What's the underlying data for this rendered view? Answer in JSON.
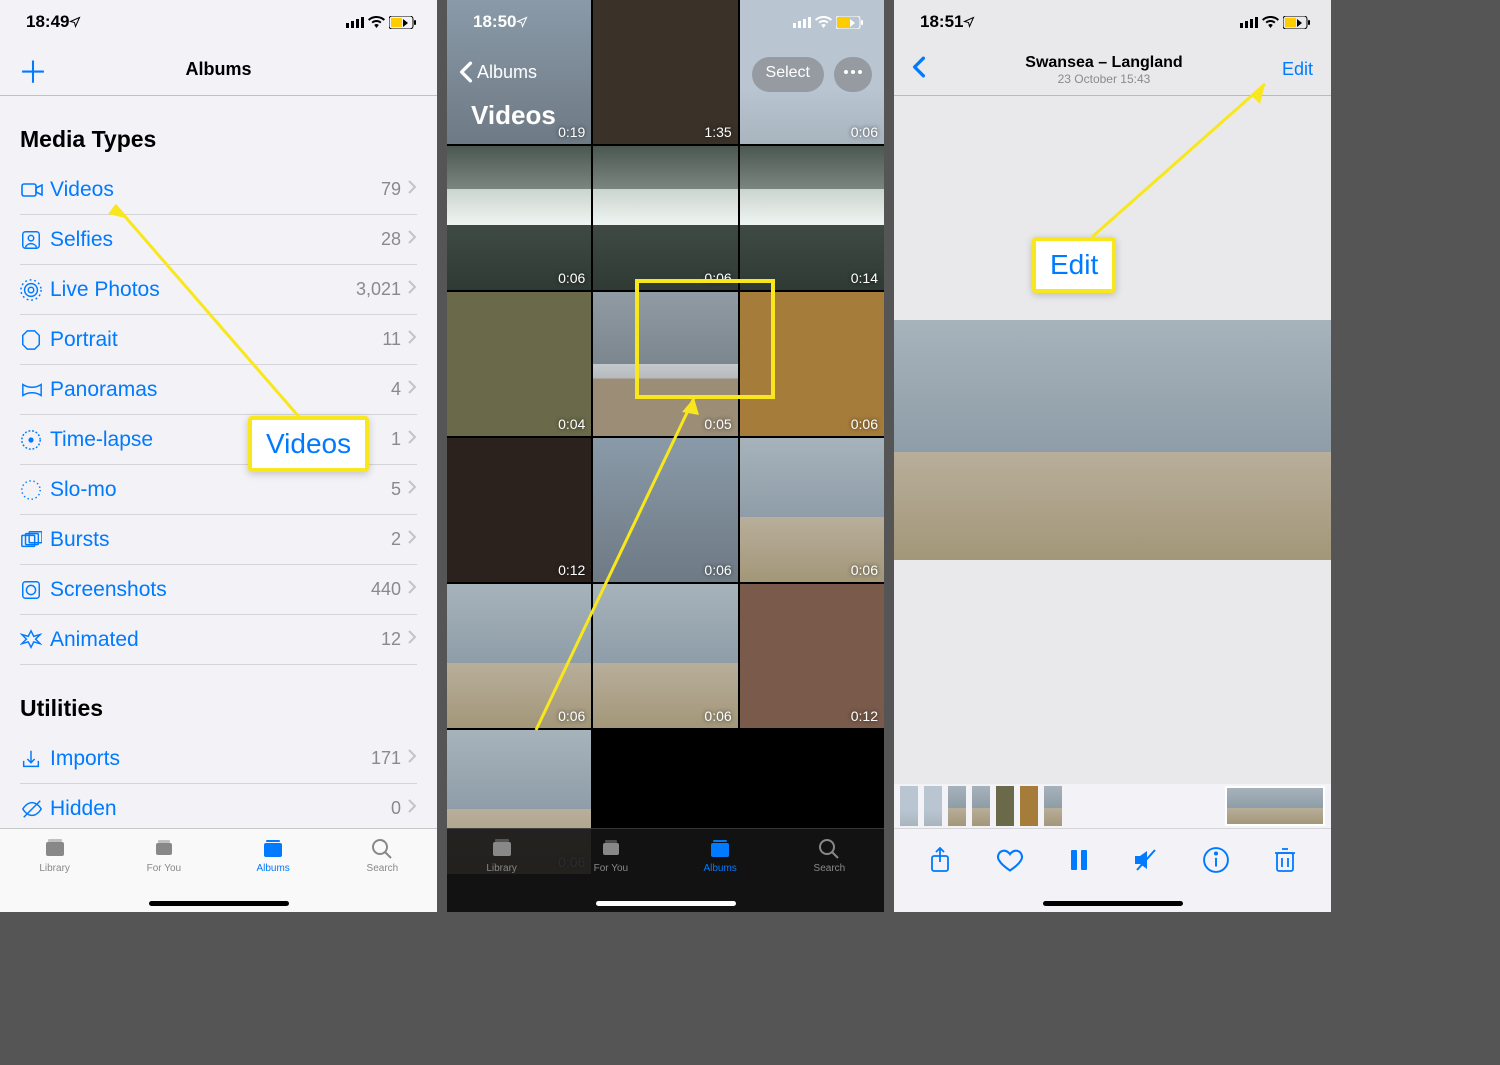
{
  "screen1": {
    "time": "18:49",
    "nav_title": "Albums",
    "section_media": "Media Types",
    "section_util": "Utilities",
    "types": [
      {
        "icon": "video",
        "label": "Videos",
        "count": "79"
      },
      {
        "icon": "selfie",
        "label": "Selfies",
        "count": "28"
      },
      {
        "icon": "live",
        "label": "Live Photos",
        "count": "3,021"
      },
      {
        "icon": "portrait",
        "label": "Portrait",
        "count": "11"
      },
      {
        "icon": "pano",
        "label": "Panoramas",
        "count": "4"
      },
      {
        "icon": "timelapse",
        "label": "Time-lapse",
        "count": "1"
      },
      {
        "icon": "slomo",
        "label": "Slo-mo",
        "count": "5"
      },
      {
        "icon": "burst",
        "label": "Bursts",
        "count": "2"
      },
      {
        "icon": "screenshot",
        "label": "Screenshots",
        "count": "440"
      },
      {
        "icon": "animated",
        "label": "Animated",
        "count": "12"
      }
    ],
    "util": [
      {
        "icon": "import",
        "label": "Imports",
        "count": "171"
      },
      {
        "icon": "hidden",
        "label": "Hidden",
        "count": "0"
      }
    ],
    "tabs": {
      "library": "Library",
      "foryou": "For You",
      "albums": "Albums",
      "search": "Search"
    }
  },
  "screen2": {
    "time": "18:50",
    "back": "Albums",
    "title": "Videos",
    "select": "Select",
    "tabs": {
      "library": "Library",
      "foryou": "For You",
      "albums": "Albums",
      "search": "Search"
    },
    "durations": [
      "0:19",
      "1:35",
      "0:06",
      "0:06",
      "0:06",
      "0:14",
      "0:04",
      "0:05",
      "0:06",
      "0:12",
      "0:06",
      "0:06",
      "0:06",
      "0:06",
      "0:12",
      "0:06"
    ]
  },
  "screen3": {
    "time": "18:51",
    "location": "Swansea – Langland",
    "datetime": "23 October  15:43",
    "edit": "Edit"
  },
  "callout_videos": "Videos",
  "callout_edit": "Edit"
}
